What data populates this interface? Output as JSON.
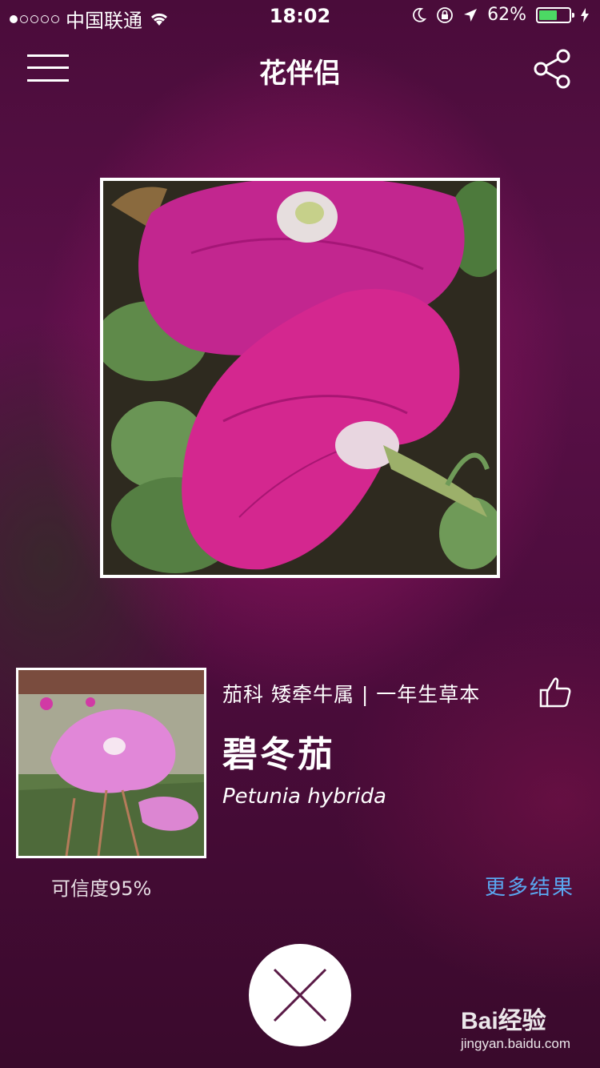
{
  "statusbar": {
    "carrier": "中国联通",
    "time": "18:02",
    "battery": "62%",
    "battery_level": 0.62,
    "signal_bars_filled": 1,
    "signal_bars_total": 5
  },
  "navbar": {
    "title": "花伴侣",
    "menu_icon": "hamburger-menu-icon",
    "share_icon": "share-icon"
  },
  "photo": {
    "subject": "photo-magenta-petunia-flowers"
  },
  "result": {
    "taxonomy": "茄科 矮牵牛属 | 一年生草本",
    "chinese_name": "碧冬茄",
    "latin_name": "Petunia hybrida",
    "confidence": "可信度95%",
    "more_results": "更多结果",
    "like_icon": "thumbs-up-icon"
  },
  "close_icon": "close-icon",
  "watermark": {
    "logo": "Bai经验",
    "url": "jingyan.baidu.com"
  },
  "colors": {
    "accent_link": "#5aa7f0",
    "battery_green": "#4cd964",
    "close_x": "#5a1a46"
  }
}
